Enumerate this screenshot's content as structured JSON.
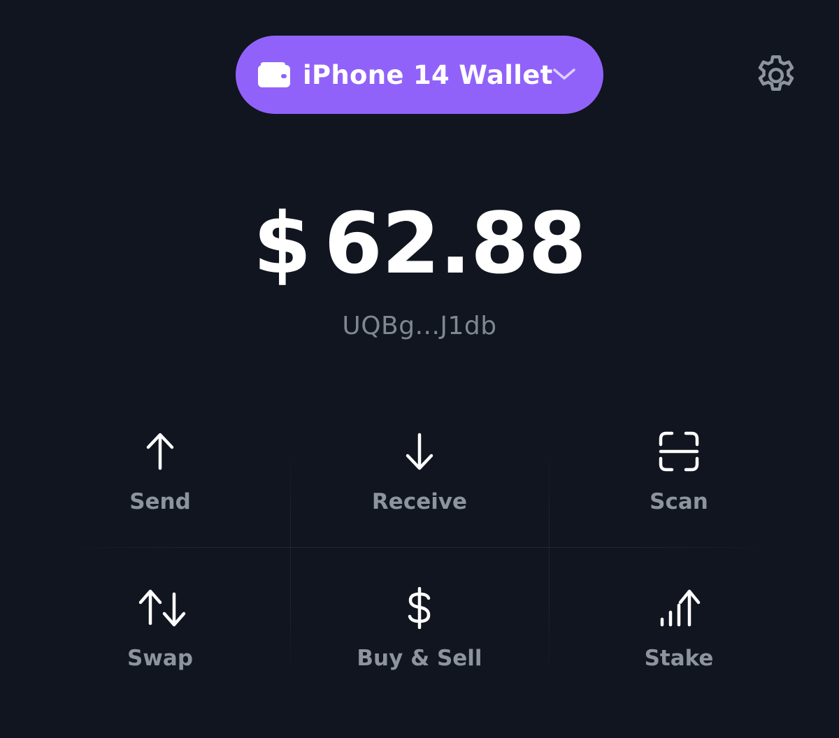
{
  "header": {
    "wallet_name": "iPhone 14 Wallet",
    "wallet_icon": "wallet-icon",
    "chevron_icon": "chevron-down-icon",
    "settings_icon": "gear-icon",
    "accent_color": "#9162fa"
  },
  "balance": {
    "currency_symbol": "$",
    "amount": "62.88"
  },
  "address": {
    "short": "UQBg...J1db"
  },
  "actions": [
    {
      "label": "Send",
      "icon": "arrow-up-icon"
    },
    {
      "label": "Receive",
      "icon": "arrow-down-icon"
    },
    {
      "label": "Scan",
      "icon": "scan-icon"
    },
    {
      "label": "Swap",
      "icon": "swap-icon"
    },
    {
      "label": "Buy & Sell",
      "icon": "dollar-icon"
    },
    {
      "label": "Stake",
      "icon": "stake-icon"
    }
  ],
  "colors": {
    "background": "#10151f",
    "primary_text": "#ffffff",
    "secondary_text": "#8d949e"
  }
}
